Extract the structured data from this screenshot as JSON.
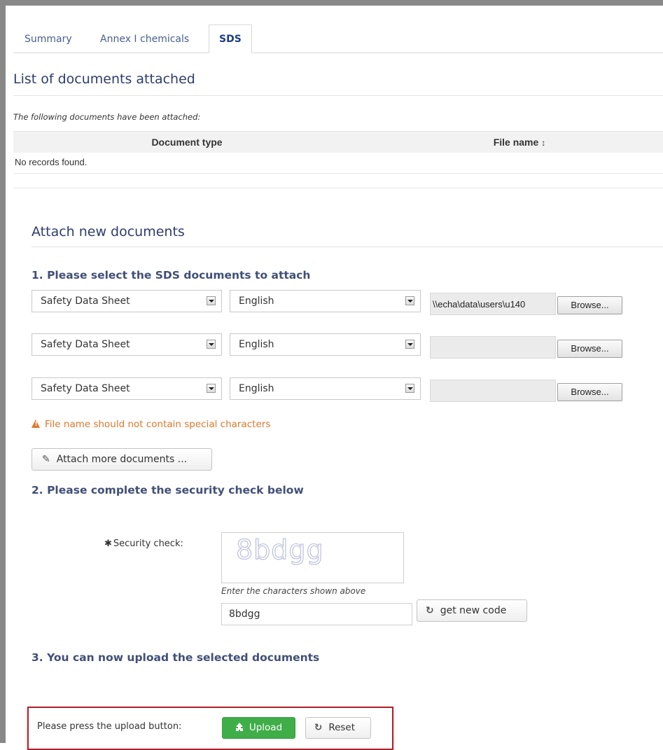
{
  "tabs": [
    {
      "label": "Summary"
    },
    {
      "label": "Annex I chemicals"
    },
    {
      "label": "SDS",
      "active": true
    }
  ],
  "list": {
    "title": "List of documents attached",
    "note": "The following documents have been attached:",
    "columns": [
      "Document type",
      "File name"
    ],
    "sort_icon": "↕",
    "empty_text": "No records found."
  },
  "attach": {
    "title": "Attach new documents",
    "step1": "1. Please select the SDS documents to attach",
    "rows": [
      {
        "doc_type": "Safety Data Sheet",
        "language": "English",
        "file": "\\\\echa\\data\\users\\u140",
        "browse": "Browse..."
      },
      {
        "doc_type": "Safety Data Sheet",
        "language": "English",
        "file": "",
        "browse": "Browse..."
      },
      {
        "doc_type": "Safety Data Sheet",
        "language": "English",
        "file": "",
        "browse": "Browse..."
      }
    ],
    "warning": "File name should not contain special characters",
    "attach_more": "Attach more documents ...",
    "step2": "2. Please complete the security check below",
    "security_label": "Security check:",
    "required_mark": "✱",
    "captcha_text": "8bdgg",
    "captcha_hint": "Enter the characters shown above",
    "code_value": "8bdgg",
    "new_code": "get new code",
    "step3": "3. You can now upload the selected documents",
    "upload_prompt": "Please press the upload button:",
    "upload": "Upload",
    "reset": "Reset"
  },
  "colors": {
    "heading": "#2e3c6e",
    "tab_text": "#47608f",
    "warning": "#e0772a",
    "upload_green": "#3fae49",
    "highlight_border": "#b0212a"
  },
  "icons": [
    "warning-icon",
    "paperclip-icon",
    "refresh-icon",
    "upload-icon",
    "sort-icon",
    "dropdown-arrow-icon"
  ]
}
